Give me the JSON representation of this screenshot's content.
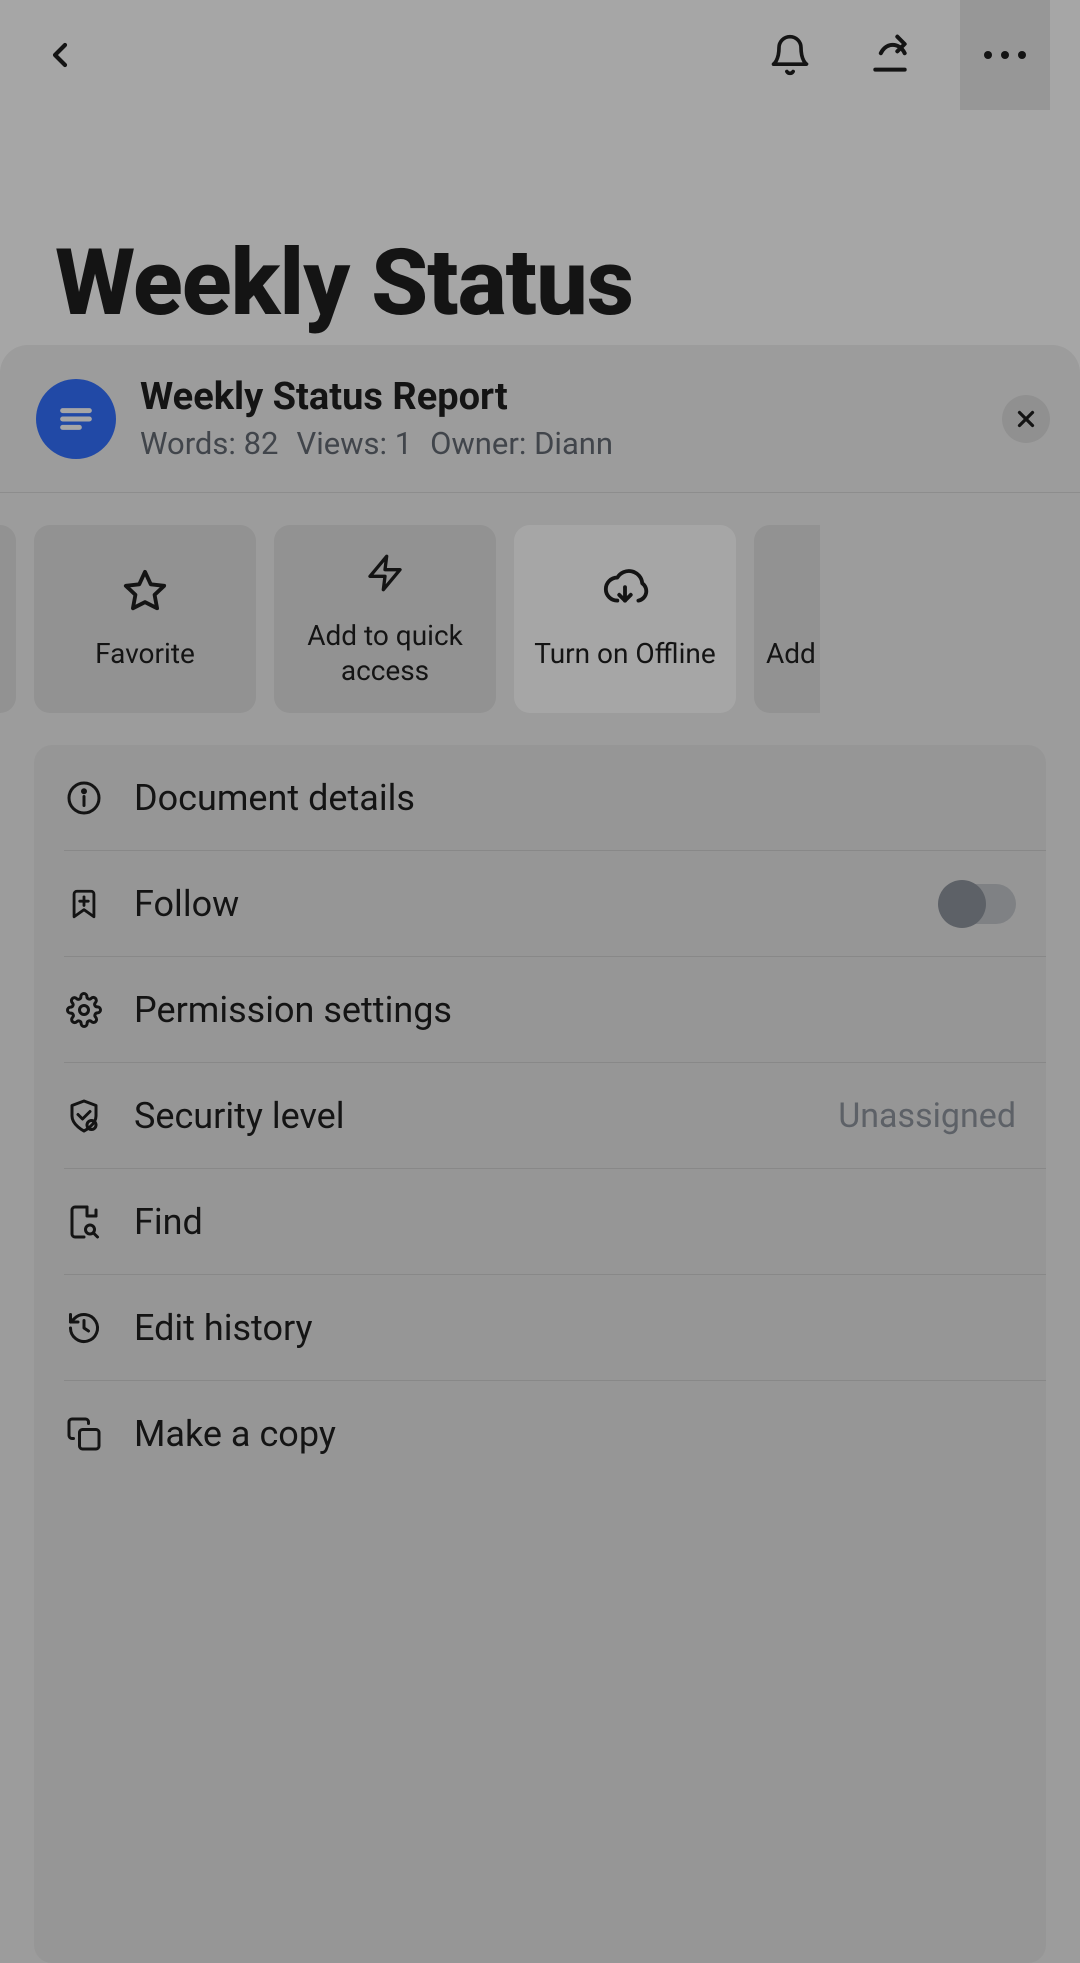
{
  "page": {
    "title": "Weekly Status"
  },
  "sheet": {
    "doc_title": "Weekly Status Report",
    "words_label": "Words:",
    "words": "82",
    "views_label": "Views:",
    "views": "1",
    "owner_label": "Owner:",
    "owner": "Diann"
  },
  "tiles": {
    "favorite": "Favorite",
    "quick_access": "Add to quick access",
    "offline": "Turn on Offline",
    "peek_right": "Add"
  },
  "menu": {
    "details": "Document details",
    "follow": "Follow",
    "permission": "Permission settings",
    "security": "Security level",
    "security_value": "Unassigned",
    "find": "Find",
    "history": "Edit history",
    "copy": "Make a copy"
  }
}
